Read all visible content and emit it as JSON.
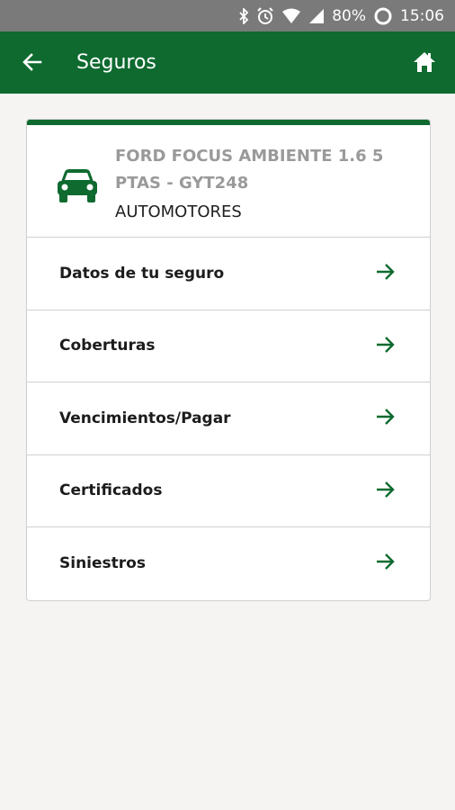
{
  "status_bar": {
    "battery": "80%",
    "time": "15:06",
    "icons": [
      "bluetooth-icon",
      "alarm-icon",
      "wifi-icon",
      "signal-icon",
      "battery-icon"
    ]
  },
  "app_bar": {
    "title": "Seguros",
    "back_icon": "arrow-left-icon",
    "home_icon": "home-icon"
  },
  "vehicle": {
    "name": "FORD FOCUS AMBIENTE 1.6 5 PTAS - GYT248",
    "type": "AUTOMOTORES",
    "icon": "car-icon"
  },
  "menu": [
    {
      "label": "Datos de tu seguro"
    },
    {
      "label": "Coberturas"
    },
    {
      "label": "Vencimientos/Pagar"
    },
    {
      "label": "Certificados"
    },
    {
      "label": "Siniestros"
    }
  ],
  "colors": {
    "primary": "#0e6a2f",
    "status_bar": "#7a7a7a",
    "background": "#f5f4f2"
  }
}
